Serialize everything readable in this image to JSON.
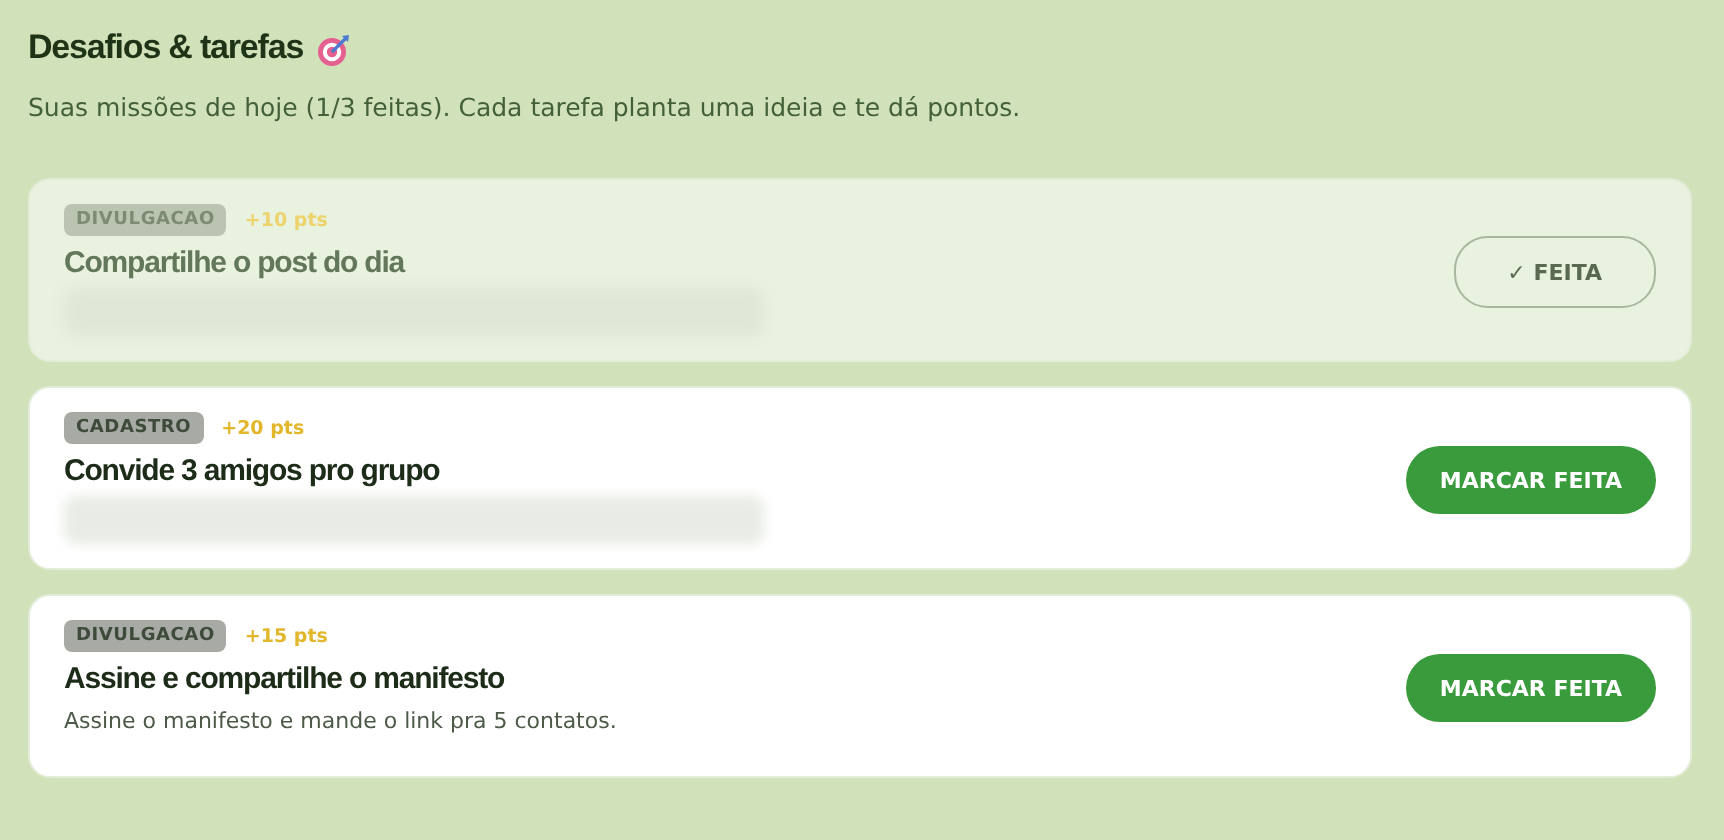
{
  "header": {
    "title": "Desafios & tarefas",
    "subtitle": "Suas missões de hoje (1/3 feitas). Cada tarefa planta uma ideia e te dá pontos."
  },
  "tasks": [
    {
      "tag": "DIVULGACAO",
      "points": "+10 pts",
      "title": "Compartilhe o post do dia",
      "description_blurred": true,
      "done": true,
      "button": "✓ FEITA"
    },
    {
      "tag": "CADASTRO",
      "points": "+20 pts",
      "title": "Convide 3 amigos pro grupo",
      "description_blurred": true,
      "done": false,
      "button": "MARCAR FEITA"
    },
    {
      "tag": "DIVULGACAO",
      "points": "+15 pts",
      "title": "Assine e compartilhe o manifesto",
      "description": "Assine o manifesto e mande o link pra 5 contatos.",
      "done": false,
      "button": "MARCAR FEITA"
    }
  ]
}
